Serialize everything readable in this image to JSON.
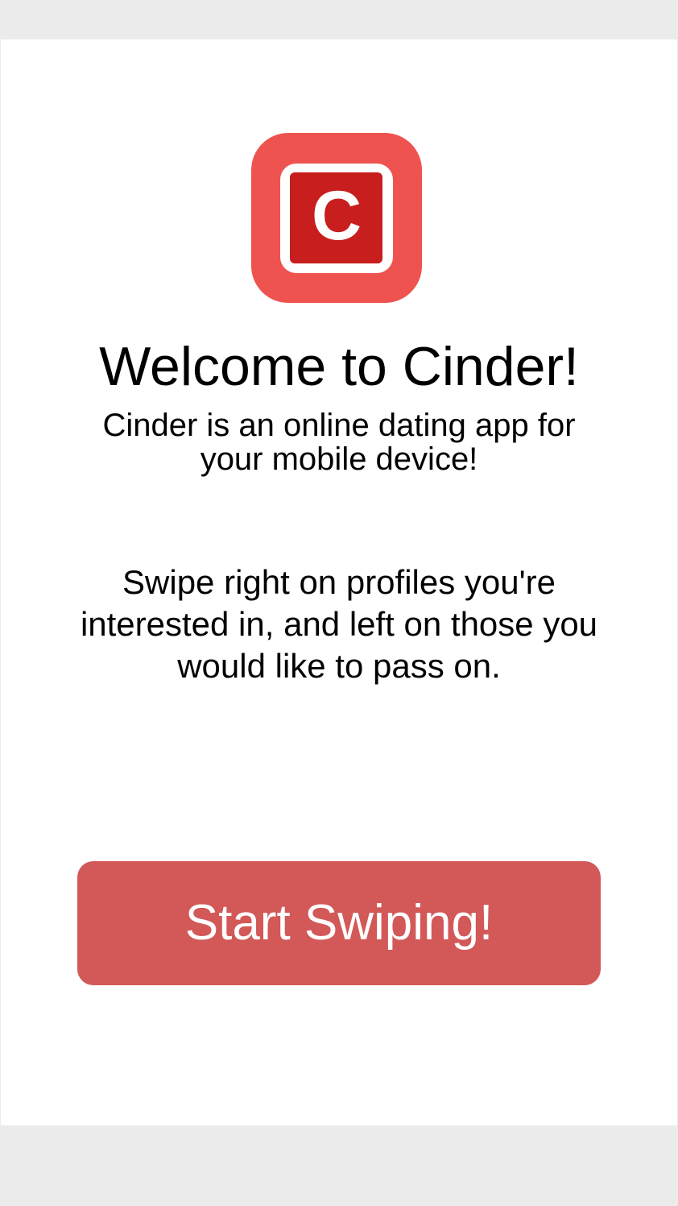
{
  "app": {
    "logo_letter": "C",
    "brand_color": "#ef5350",
    "logo_inner_color": "#c81e1e"
  },
  "welcome": {
    "title": "Welcome to Cinder!",
    "subtitle": "Cinder is an online dating app for your mobile device!",
    "instructions": "Swipe right on profiles you're interested in, and left on those you would like to pass on."
  },
  "actions": {
    "start_label": "Start Swiping!",
    "button_color": "#d35858"
  }
}
